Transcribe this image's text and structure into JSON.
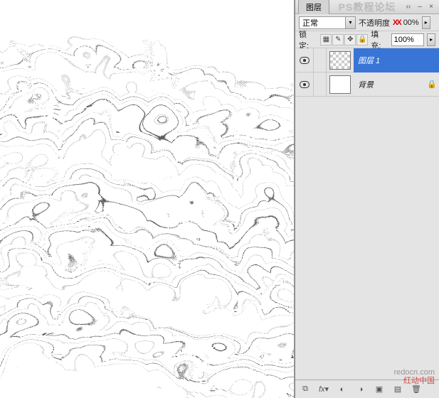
{
  "titlebar": {
    "tab_label": "图层",
    "watermark": "PS教程论坛"
  },
  "blend": {
    "mode": "正常",
    "opacity_label": "不透明度",
    "opacity_xx": "XX",
    "opacity_value": "00%"
  },
  "lock": {
    "label": "锁定:",
    "fill_label": "填充:",
    "fill_value": "100%"
  },
  "layers": [
    {
      "name": "图层 1",
      "active": true,
      "transparent": true,
      "locked": false
    },
    {
      "name": "背景",
      "active": false,
      "transparent": false,
      "locked": true
    }
  ],
  "footer_watermark": {
    "url": "redocn.com",
    "brand": "红动中国"
  }
}
